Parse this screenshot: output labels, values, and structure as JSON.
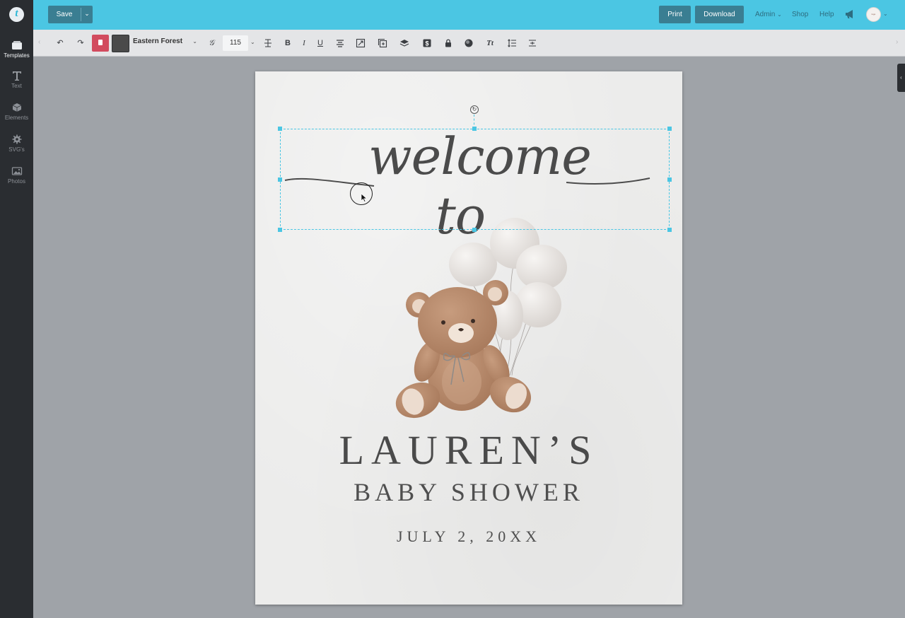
{
  "app": {
    "logo_letter": "t"
  },
  "sidebar": {
    "items": [
      {
        "label": "Templates",
        "icon": "folder-icon",
        "active": true
      },
      {
        "label": "Text",
        "icon": "text-icon",
        "active": false
      },
      {
        "label": "Elements",
        "icon": "cube-icon",
        "active": false
      },
      {
        "label": "SVG's",
        "icon": "gear-icon",
        "active": false
      },
      {
        "label": "Photos",
        "icon": "image-icon",
        "active": false
      }
    ]
  },
  "topbar": {
    "save_label": "Save",
    "print_label": "Print",
    "download_label": "Download",
    "nav": {
      "admin": "Admin",
      "shop": "Shop",
      "help": "Help"
    },
    "avatar_text": "logo"
  },
  "toolbar": {
    "font_name": "Eastern Forest",
    "font_size": "115",
    "text_color": "#4a4a4a",
    "delete_color": "#d24b5e",
    "icons": [
      "undo-icon",
      "redo-icon",
      "delete-icon",
      "color-swatch",
      "font-icon",
      "letter-spacing-icon",
      "bold-icon",
      "italic-icon",
      "underline-icon",
      "align-center-icon",
      "resize-icon",
      "duplicate-icon",
      "layers-icon",
      "dollar-icon",
      "lock-icon",
      "effects-icon",
      "text-case-icon",
      "line-height-icon",
      "fit-icon"
    ]
  },
  "canvas": {
    "script_text": "welcome to",
    "name": "LAUREN’S",
    "subtitle": "BABY SHOWER",
    "date": "JULY 2, 20XX"
  },
  "colors": {
    "accent": "#4bc6e3",
    "button": "#3a7e92",
    "rail": "#2a2d31",
    "page": "#ececeb"
  }
}
